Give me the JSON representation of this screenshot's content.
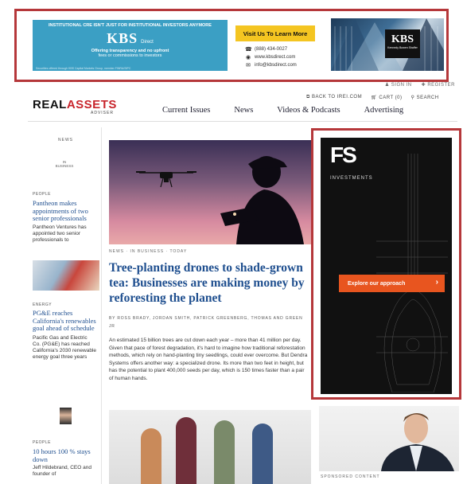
{
  "top_ad": {
    "tagline": "Institutional CRE isn't just for institutional investors anymore",
    "logo": "KBS",
    "logo_sub": "Direct",
    "line1": "Offering transparency and no upfront",
    "line2": "fees or commissions to investors",
    "disclaimer": "Securities offered through KBS Capital Markets Group, member FINRA/SIPC",
    "cta": "Visit Us To Learn More",
    "contacts": [
      {
        "icon": "phone-icon",
        "text": "(888) 434-0027"
      },
      {
        "icon": "globe-icon",
        "text": "www.kbsdirect.com"
      },
      {
        "icon": "mail-icon",
        "text": "info@kbsdirect.com"
      }
    ],
    "photo_logo": "KBS",
    "photo_logo_sub": "Kennedy Bowen Shaffer"
  },
  "header": {
    "user_links": [
      "SIGN IN",
      "REGISTER"
    ],
    "logo_part1": "REAL",
    "logo_part2": "ASSETS",
    "logo_sub": "ADVISER",
    "utility_links": [
      "BACK TO IREI.COM",
      "CART (0)",
      "SEARCH"
    ],
    "nav": [
      "Current Issues",
      "News",
      "Videos & Podcasts",
      "Advertising"
    ]
  },
  "sidebar": {
    "news_label": "NEWS",
    "top_label": "IN BUSINESS",
    "stories": [
      {
        "category": "PEOPLE",
        "title": "Pantheon makes appointments of two senior professionals",
        "body": "Pantheon Ventures has appointed two senior professionals to"
      },
      {
        "category": "ENERGY",
        "title": "PG&E reaches California's renewables goal ahead of schedule",
        "body": "Pacific Gas and Electric Co. (PG&E) has reached California's 2030 renewable energy goal three years"
      },
      {
        "category": "PEOPLE",
        "title": "10 hours 100 % stays down",
        "body": "Jeff Hildebrand, CEO and founder of"
      }
    ]
  },
  "hero": {
    "kicker": "NEWS · IN BUSINESS · TODAY",
    "title": "Tree-planting drones to shade-grown tea: Businesses are making money by reforesting the planet",
    "byline": "BY ROSS BRADY, JORDAN SMITH, PATRICK GREENBERG, THOMAS AND GREEN JR",
    "summary": "An estimated 15 billion trees are cut down each year – more than 41 million per day. Given that pace of forest degradation, it's hard to imagine how traditional reforestation methods, which rely on hand-planting tiny seedlings, could ever overcome. But Dendra Systems offers another way: a specialized drone. Its more than two feet in height, but has the potential to plant 400,000 seeds per day, which is 150 times faster than a pair of human hands."
  },
  "side_ad": {
    "logo": "FS",
    "investments": "INVESTMENTS",
    "cta": "Explore our approach",
    "cta_arrow": "›"
  },
  "sponsored": {
    "label": "SPONSORED CONTENT"
  },
  "colors": {
    "accent_red": "#c8242b",
    "link_blue": "#1f4f8f",
    "ad_border": "#b5373a",
    "kbs_blue": "#3b9fc4",
    "cta_yellow": "#f4c521",
    "fs_orange": "#e8551f"
  }
}
